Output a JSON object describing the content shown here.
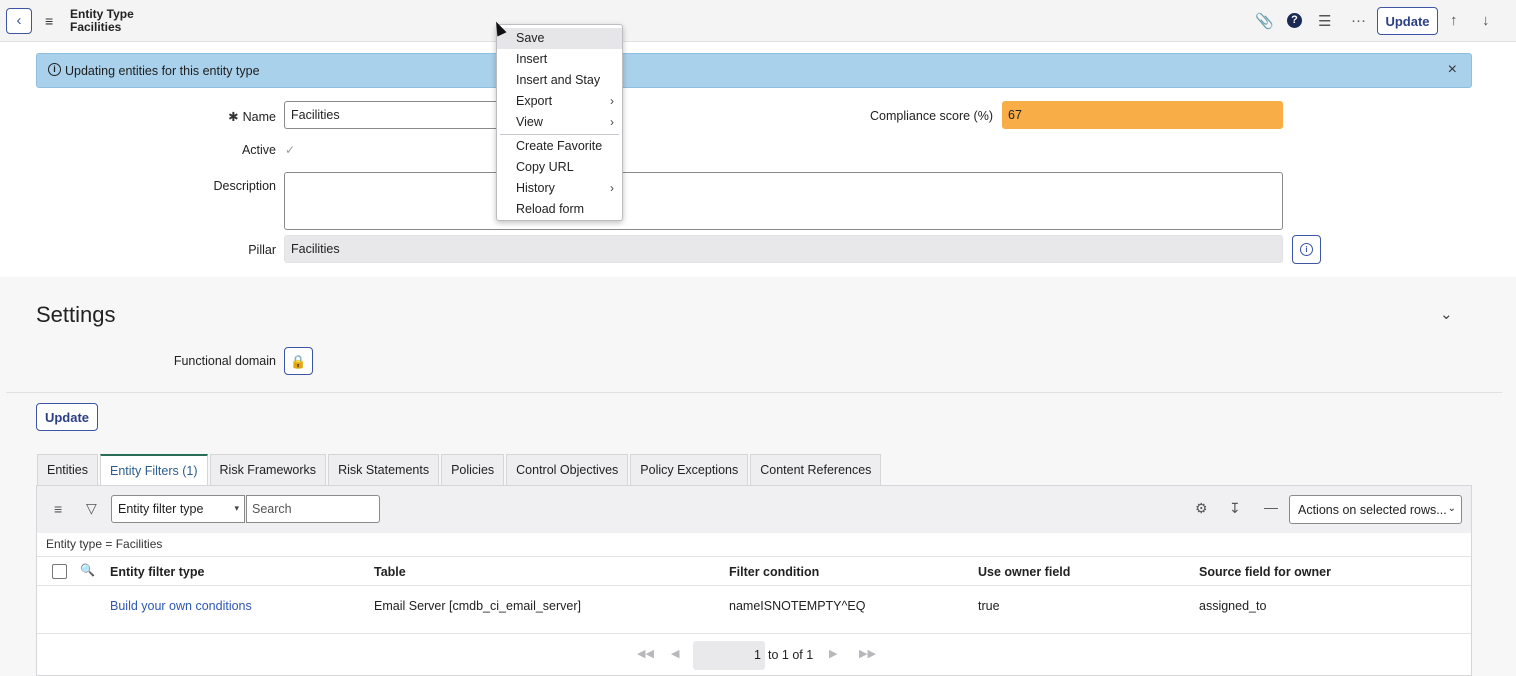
{
  "header": {
    "back_icon": "chevron-left-icon",
    "record_type": "Entity Type",
    "record_name": "Facilities",
    "update_label": "Update"
  },
  "banner": {
    "message": "Updating entities for this entity type"
  },
  "form": {
    "name_label": "Name",
    "name_value": "Facilities",
    "active_label": "Active",
    "description_label": "Description",
    "pillar_label": "Pillar",
    "pillar_value": "Facilities",
    "compliance_label": "Compliance score (%)",
    "compliance_value": "67",
    "compliance_color": "#f9ad47"
  },
  "context_menu": {
    "items": [
      {
        "label": "Save",
        "highlighted": true
      },
      {
        "label": "Insert"
      },
      {
        "label": "Insert and Stay"
      },
      {
        "label": "Export",
        "submenu": true
      },
      {
        "label": "View",
        "submenu": true
      },
      {
        "label": "Create Favorite"
      },
      {
        "label": "Copy URL"
      },
      {
        "label": "History",
        "submenu": true
      },
      {
        "label": "Reload form"
      }
    ]
  },
  "settings": {
    "title": "Settings",
    "functional_domain_label": "Functional domain",
    "update_label": "Update"
  },
  "tabs": [
    {
      "label": "Entities"
    },
    {
      "label": "Entity Filters (1)",
      "active": true
    },
    {
      "label": "Risk Frameworks"
    },
    {
      "label": "Risk Statements"
    },
    {
      "label": "Policies"
    },
    {
      "label": "Control Objectives"
    },
    {
      "label": "Policy Exceptions"
    },
    {
      "label": "Content References"
    }
  ],
  "list": {
    "filter_select": "Entity filter type",
    "search_placeholder": "Search",
    "actions_label": "Actions on selected rows...",
    "breadcrumb": "Entity type = Facilities",
    "columns": [
      "Entity filter type",
      "Table",
      "Filter condition",
      "Use owner field",
      "Source field for owner"
    ],
    "rows": [
      [
        "Build your own conditions",
        "Email Server [cmdb_ci_email_server]",
        "nameISNOTEMPTY^EQ",
        "true",
        "assigned_to"
      ]
    ],
    "pager": {
      "current": "1",
      "summary": "to 1 of 1"
    }
  }
}
